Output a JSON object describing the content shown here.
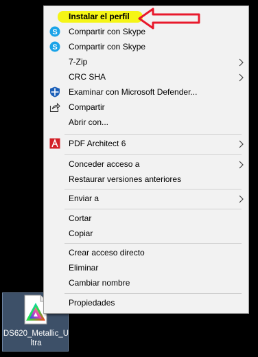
{
  "menu": {
    "items": [
      {
        "label": "Instalar el perfil",
        "icon": "none",
        "submenu": false
      },
      {
        "label": "Compartir con Skype",
        "icon": "skype-icon",
        "submenu": false
      },
      {
        "label": "Compartir con Skype",
        "icon": "skype-icon",
        "submenu": false
      },
      {
        "label": "7-Zip",
        "icon": "none",
        "submenu": true
      },
      {
        "label": "CRC SHA",
        "icon": "none",
        "submenu": true
      },
      {
        "label": "Examinar con Microsoft Defender...",
        "icon": "defender-shield-icon",
        "submenu": false
      },
      {
        "label": "Compartir",
        "icon": "share-icon",
        "submenu": false
      },
      {
        "label": "Abrir con...",
        "icon": "none",
        "submenu": false
      },
      {
        "label": "PDF Architect 6",
        "icon": "pdf-architect-icon",
        "submenu": true
      },
      {
        "label": "Conceder acceso a",
        "icon": "none",
        "submenu": true
      },
      {
        "label": "Restaurar versiones anteriores",
        "icon": "none",
        "submenu": false
      },
      {
        "label": "Enviar a",
        "icon": "none",
        "submenu": true
      },
      {
        "label": "Cortar",
        "icon": "none",
        "submenu": false
      },
      {
        "label": "Copiar",
        "icon": "none",
        "submenu": false
      },
      {
        "label": "Crear acceso directo",
        "icon": "none",
        "submenu": false
      },
      {
        "label": "Eliminar",
        "icon": "none",
        "submenu": false
      },
      {
        "label": "Cambiar nombre",
        "icon": "none",
        "submenu": false
      },
      {
        "label": "Propiedades",
        "icon": "none",
        "submenu": false
      }
    ]
  },
  "desktop": {
    "file_label": "DS620_Metallic_Ultra",
    "file_icon": "color-profile-icon"
  },
  "annotations": {
    "highlight_color": "#f4f40a",
    "arrow_color": "#e8192c",
    "arrow_icon": "red-arrow-icon"
  }
}
